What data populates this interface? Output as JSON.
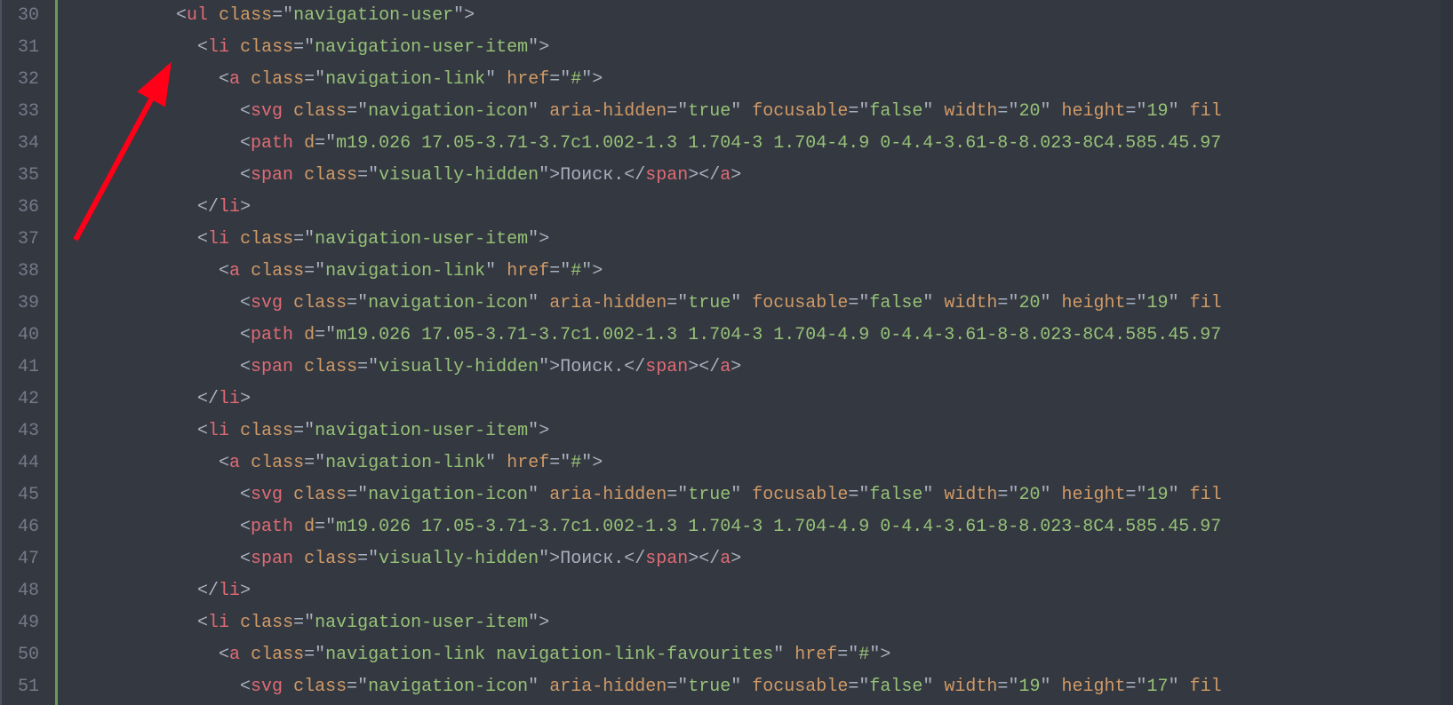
{
  "lineNumbers": [
    "30",
    "31",
    "32",
    "33",
    "34",
    "35",
    "36",
    "37",
    "38",
    "39",
    "40",
    "41",
    "42",
    "43",
    "44",
    "45",
    "46",
    "47",
    "48",
    "49",
    "50",
    "51"
  ],
  "code": {
    "l30": {
      "indent": "          ",
      "parts": [
        [
          "punct",
          "<"
        ],
        [
          "tag",
          "ul"
        ],
        [
          "text",
          " "
        ],
        [
          "attr",
          "class"
        ],
        [
          "eq",
          "="
        ],
        [
          "punct",
          "\""
        ],
        [
          "str",
          "navigation-user"
        ],
        [
          "punct",
          "\""
        ],
        [
          "punct",
          ">"
        ]
      ]
    },
    "l31": {
      "indent": "            ",
      "parts": [
        [
          "punct",
          "<"
        ],
        [
          "tag",
          "li"
        ],
        [
          "text",
          " "
        ],
        [
          "attr",
          "class"
        ],
        [
          "eq",
          "="
        ],
        [
          "punct",
          "\""
        ],
        [
          "str",
          "navigation-user-item"
        ],
        [
          "punct",
          "\""
        ],
        [
          "punct",
          ">"
        ]
      ]
    },
    "l32": {
      "indent": "              ",
      "parts": [
        [
          "punct",
          "<"
        ],
        [
          "tag",
          "a"
        ],
        [
          "text",
          " "
        ],
        [
          "attr",
          "class"
        ],
        [
          "eq",
          "="
        ],
        [
          "punct",
          "\""
        ],
        [
          "str",
          "navigation-link"
        ],
        [
          "punct",
          "\""
        ],
        [
          "text",
          " "
        ],
        [
          "attr",
          "href"
        ],
        [
          "eq",
          "="
        ],
        [
          "punct",
          "\""
        ],
        [
          "str",
          "#"
        ],
        [
          "punct",
          "\""
        ],
        [
          "punct",
          ">"
        ]
      ]
    },
    "l33": {
      "indent": "                ",
      "parts": [
        [
          "punct",
          "<"
        ],
        [
          "tag",
          "svg"
        ],
        [
          "text",
          " "
        ],
        [
          "attr",
          "class"
        ],
        [
          "eq",
          "="
        ],
        [
          "punct",
          "\""
        ],
        [
          "str",
          "navigation-icon"
        ],
        [
          "punct",
          "\""
        ],
        [
          "text",
          " "
        ],
        [
          "attr",
          "aria-hidden"
        ],
        [
          "eq",
          "="
        ],
        [
          "punct",
          "\""
        ],
        [
          "str",
          "true"
        ],
        [
          "punct",
          "\""
        ],
        [
          "text",
          " "
        ],
        [
          "attr",
          "focusable"
        ],
        [
          "eq",
          "="
        ],
        [
          "punct",
          "\""
        ],
        [
          "str",
          "false"
        ],
        [
          "punct",
          "\""
        ],
        [
          "text",
          " "
        ],
        [
          "attr",
          "width"
        ],
        [
          "eq",
          "="
        ],
        [
          "punct",
          "\""
        ],
        [
          "str",
          "20"
        ],
        [
          "punct",
          "\""
        ],
        [
          "text",
          " "
        ],
        [
          "attr",
          "height"
        ],
        [
          "eq",
          "="
        ],
        [
          "punct",
          "\""
        ],
        [
          "str",
          "19"
        ],
        [
          "punct",
          "\""
        ],
        [
          "text",
          " "
        ],
        [
          "attr",
          "fil"
        ]
      ]
    },
    "l34": {
      "indent": "                ",
      "parts": [
        [
          "punct",
          "<"
        ],
        [
          "tag",
          "path"
        ],
        [
          "text",
          " "
        ],
        [
          "attr",
          "d"
        ],
        [
          "eq",
          "="
        ],
        [
          "punct",
          "\""
        ],
        [
          "str",
          "m19.026 17.05-3.71-3.7c1.002-1.3 1.704-3 1.704-4.9 0-4.4-3.61-8-8.023-8C4.585.45.97"
        ]
      ]
    },
    "l35": {
      "indent": "                ",
      "parts": [
        [
          "punct",
          "<"
        ],
        [
          "tag",
          "span"
        ],
        [
          "text",
          " "
        ],
        [
          "attr",
          "class"
        ],
        [
          "eq",
          "="
        ],
        [
          "punct",
          "\""
        ],
        [
          "str",
          "visually-hidden"
        ],
        [
          "punct",
          "\""
        ],
        [
          "punct",
          ">"
        ],
        [
          "text",
          "Поиск."
        ],
        [
          "punct",
          "</"
        ],
        [
          "tag",
          "span"
        ],
        [
          "punct",
          ">"
        ],
        [
          "punct",
          "</"
        ],
        [
          "tag",
          "a"
        ],
        [
          "punct",
          ">"
        ]
      ]
    },
    "l36": {
      "indent": "            ",
      "parts": [
        [
          "punct",
          "</"
        ],
        [
          "tag",
          "li"
        ],
        [
          "punct",
          ">"
        ]
      ]
    },
    "l37": {
      "indent": "            ",
      "parts": [
        [
          "punct",
          "<"
        ],
        [
          "tag",
          "li"
        ],
        [
          "text",
          " "
        ],
        [
          "attr",
          "class"
        ],
        [
          "eq",
          "="
        ],
        [
          "punct",
          "\""
        ],
        [
          "str",
          "navigation-user-item"
        ],
        [
          "punct",
          "\""
        ],
        [
          "punct",
          ">"
        ]
      ]
    },
    "l38": {
      "indent": "              ",
      "parts": [
        [
          "punct",
          "<"
        ],
        [
          "tag",
          "a"
        ],
        [
          "text",
          " "
        ],
        [
          "attr",
          "class"
        ],
        [
          "eq",
          "="
        ],
        [
          "punct",
          "\""
        ],
        [
          "str",
          "navigation-link"
        ],
        [
          "punct",
          "\""
        ],
        [
          "text",
          " "
        ],
        [
          "attr",
          "href"
        ],
        [
          "eq",
          "="
        ],
        [
          "punct",
          "\""
        ],
        [
          "str",
          "#"
        ],
        [
          "punct",
          "\""
        ],
        [
          "punct",
          ">"
        ]
      ]
    },
    "l39": {
      "indent": "                ",
      "parts": [
        [
          "punct",
          "<"
        ],
        [
          "tag",
          "svg"
        ],
        [
          "text",
          " "
        ],
        [
          "attr",
          "class"
        ],
        [
          "eq",
          "="
        ],
        [
          "punct",
          "\""
        ],
        [
          "str",
          "navigation-icon"
        ],
        [
          "punct",
          "\""
        ],
        [
          "text",
          " "
        ],
        [
          "attr",
          "aria-hidden"
        ],
        [
          "eq",
          "="
        ],
        [
          "punct",
          "\""
        ],
        [
          "str",
          "true"
        ],
        [
          "punct",
          "\""
        ],
        [
          "text",
          " "
        ],
        [
          "attr",
          "focusable"
        ],
        [
          "eq",
          "="
        ],
        [
          "punct",
          "\""
        ],
        [
          "str",
          "false"
        ],
        [
          "punct",
          "\""
        ],
        [
          "text",
          " "
        ],
        [
          "attr",
          "width"
        ],
        [
          "eq",
          "="
        ],
        [
          "punct",
          "\""
        ],
        [
          "str",
          "20"
        ],
        [
          "punct",
          "\""
        ],
        [
          "text",
          " "
        ],
        [
          "attr",
          "height"
        ],
        [
          "eq",
          "="
        ],
        [
          "punct",
          "\""
        ],
        [
          "str",
          "19"
        ],
        [
          "punct",
          "\""
        ],
        [
          "text",
          " "
        ],
        [
          "attr",
          "fil"
        ]
      ]
    },
    "l40": {
      "indent": "                ",
      "parts": [
        [
          "punct",
          "<"
        ],
        [
          "tag",
          "path"
        ],
        [
          "text",
          " "
        ],
        [
          "attr",
          "d"
        ],
        [
          "eq",
          "="
        ],
        [
          "punct",
          "\""
        ],
        [
          "str",
          "m19.026 17.05-3.71-3.7c1.002-1.3 1.704-3 1.704-4.9 0-4.4-3.61-8-8.023-8C4.585.45.97"
        ]
      ]
    },
    "l41": {
      "indent": "                ",
      "parts": [
        [
          "punct",
          "<"
        ],
        [
          "tag",
          "span"
        ],
        [
          "text",
          " "
        ],
        [
          "attr",
          "class"
        ],
        [
          "eq",
          "="
        ],
        [
          "punct",
          "\""
        ],
        [
          "str",
          "visually-hidden"
        ],
        [
          "punct",
          "\""
        ],
        [
          "punct",
          ">"
        ],
        [
          "text",
          "Поиск."
        ],
        [
          "punct",
          "</"
        ],
        [
          "tag",
          "span"
        ],
        [
          "punct",
          ">"
        ],
        [
          "punct",
          "</"
        ],
        [
          "tag",
          "a"
        ],
        [
          "punct",
          ">"
        ]
      ]
    },
    "l42": {
      "indent": "            ",
      "parts": [
        [
          "punct",
          "</"
        ],
        [
          "tag",
          "li"
        ],
        [
          "punct",
          ">"
        ]
      ]
    },
    "l43": {
      "indent": "            ",
      "parts": [
        [
          "punct",
          "<"
        ],
        [
          "tag",
          "li"
        ],
        [
          "text",
          " "
        ],
        [
          "attr",
          "class"
        ],
        [
          "eq",
          "="
        ],
        [
          "punct",
          "\""
        ],
        [
          "str",
          "navigation-user-item"
        ],
        [
          "punct",
          "\""
        ],
        [
          "punct",
          ">"
        ]
      ]
    },
    "l44": {
      "indent": "              ",
      "parts": [
        [
          "punct",
          "<"
        ],
        [
          "tag",
          "a"
        ],
        [
          "text",
          " "
        ],
        [
          "attr",
          "class"
        ],
        [
          "eq",
          "="
        ],
        [
          "punct",
          "\""
        ],
        [
          "str",
          "navigation-link"
        ],
        [
          "punct",
          "\""
        ],
        [
          "text",
          " "
        ],
        [
          "attr",
          "href"
        ],
        [
          "eq",
          "="
        ],
        [
          "punct",
          "\""
        ],
        [
          "str",
          "#"
        ],
        [
          "punct",
          "\""
        ],
        [
          "punct",
          ">"
        ]
      ]
    },
    "l45": {
      "indent": "                ",
      "parts": [
        [
          "punct",
          "<"
        ],
        [
          "tag",
          "svg"
        ],
        [
          "text",
          " "
        ],
        [
          "attr",
          "class"
        ],
        [
          "eq",
          "="
        ],
        [
          "punct",
          "\""
        ],
        [
          "str",
          "navigation-icon"
        ],
        [
          "punct",
          "\""
        ],
        [
          "text",
          " "
        ],
        [
          "attr",
          "aria-hidden"
        ],
        [
          "eq",
          "="
        ],
        [
          "punct",
          "\""
        ],
        [
          "str",
          "true"
        ],
        [
          "punct",
          "\""
        ],
        [
          "text",
          " "
        ],
        [
          "attr",
          "focusable"
        ],
        [
          "eq",
          "="
        ],
        [
          "punct",
          "\""
        ],
        [
          "str",
          "false"
        ],
        [
          "punct",
          "\""
        ],
        [
          "text",
          " "
        ],
        [
          "attr",
          "width"
        ],
        [
          "eq",
          "="
        ],
        [
          "punct",
          "\""
        ],
        [
          "str",
          "20"
        ],
        [
          "punct",
          "\""
        ],
        [
          "text",
          " "
        ],
        [
          "attr",
          "height"
        ],
        [
          "eq",
          "="
        ],
        [
          "punct",
          "\""
        ],
        [
          "str",
          "19"
        ],
        [
          "punct",
          "\""
        ],
        [
          "text",
          " "
        ],
        [
          "attr",
          "fil"
        ]
      ]
    },
    "l46": {
      "indent": "                ",
      "parts": [
        [
          "punct",
          "<"
        ],
        [
          "tag",
          "path"
        ],
        [
          "text",
          " "
        ],
        [
          "attr",
          "d"
        ],
        [
          "eq",
          "="
        ],
        [
          "punct",
          "\""
        ],
        [
          "str",
          "m19.026 17.05-3.71-3.7c1.002-1.3 1.704-3 1.704-4.9 0-4.4-3.61-8-8.023-8C4.585.45.97"
        ]
      ]
    },
    "l47": {
      "indent": "                ",
      "parts": [
        [
          "punct",
          "<"
        ],
        [
          "tag",
          "span"
        ],
        [
          "text",
          " "
        ],
        [
          "attr",
          "class"
        ],
        [
          "eq",
          "="
        ],
        [
          "punct",
          "\""
        ],
        [
          "str",
          "visually-hidden"
        ],
        [
          "punct",
          "\""
        ],
        [
          "punct",
          ">"
        ],
        [
          "text",
          "Поиск."
        ],
        [
          "punct",
          "</"
        ],
        [
          "tag",
          "span"
        ],
        [
          "punct",
          ">"
        ],
        [
          "punct",
          "</"
        ],
        [
          "tag",
          "a"
        ],
        [
          "punct",
          ">"
        ]
      ]
    },
    "l48": {
      "indent": "            ",
      "parts": [
        [
          "punct",
          "</"
        ],
        [
          "tag",
          "li"
        ],
        [
          "punct",
          ">"
        ]
      ]
    },
    "l49": {
      "indent": "            ",
      "parts": [
        [
          "punct",
          "<"
        ],
        [
          "tag",
          "li"
        ],
        [
          "text",
          " "
        ],
        [
          "attr",
          "class"
        ],
        [
          "eq",
          "="
        ],
        [
          "punct",
          "\""
        ],
        [
          "str",
          "navigation-user-item"
        ],
        [
          "punct",
          "\""
        ],
        [
          "punct",
          ">"
        ]
      ]
    },
    "l50": {
      "indent": "              ",
      "parts": [
        [
          "punct",
          "<"
        ],
        [
          "tag",
          "a"
        ],
        [
          "text",
          " "
        ],
        [
          "attr",
          "class"
        ],
        [
          "eq",
          "="
        ],
        [
          "punct",
          "\""
        ],
        [
          "str",
          "navigation-link navigation-link-favourites"
        ],
        [
          "punct",
          "\""
        ],
        [
          "text",
          " "
        ],
        [
          "attr",
          "href"
        ],
        [
          "eq",
          "="
        ],
        [
          "punct",
          "\""
        ],
        [
          "str",
          "#"
        ],
        [
          "punct",
          "\""
        ],
        [
          "punct",
          ">"
        ]
      ]
    },
    "l51": {
      "indent": "                ",
      "parts": [
        [
          "punct",
          "<"
        ],
        [
          "tag",
          "svg"
        ],
        [
          "text",
          " "
        ],
        [
          "attr",
          "class"
        ],
        [
          "eq",
          "="
        ],
        [
          "punct",
          "\""
        ],
        [
          "str",
          "navigation-icon"
        ],
        [
          "punct",
          "\""
        ],
        [
          "text",
          " "
        ],
        [
          "attr",
          "aria-hidden"
        ],
        [
          "eq",
          "="
        ],
        [
          "punct",
          "\""
        ],
        [
          "str",
          "true"
        ],
        [
          "punct",
          "\""
        ],
        [
          "text",
          " "
        ],
        [
          "attr",
          "focusable"
        ],
        [
          "eq",
          "="
        ],
        [
          "punct",
          "\""
        ],
        [
          "str",
          "false"
        ],
        [
          "punct",
          "\""
        ],
        [
          "text",
          " "
        ],
        [
          "attr",
          "width"
        ],
        [
          "eq",
          "="
        ],
        [
          "punct",
          "\""
        ],
        [
          "str",
          "19"
        ],
        [
          "punct",
          "\""
        ],
        [
          "text",
          " "
        ],
        [
          "attr",
          "height"
        ],
        [
          "eq",
          "="
        ],
        [
          "punct",
          "\""
        ],
        [
          "str",
          "17"
        ],
        [
          "punct",
          "\""
        ],
        [
          "text",
          " "
        ],
        [
          "attr",
          "fil"
        ]
      ]
    }
  }
}
